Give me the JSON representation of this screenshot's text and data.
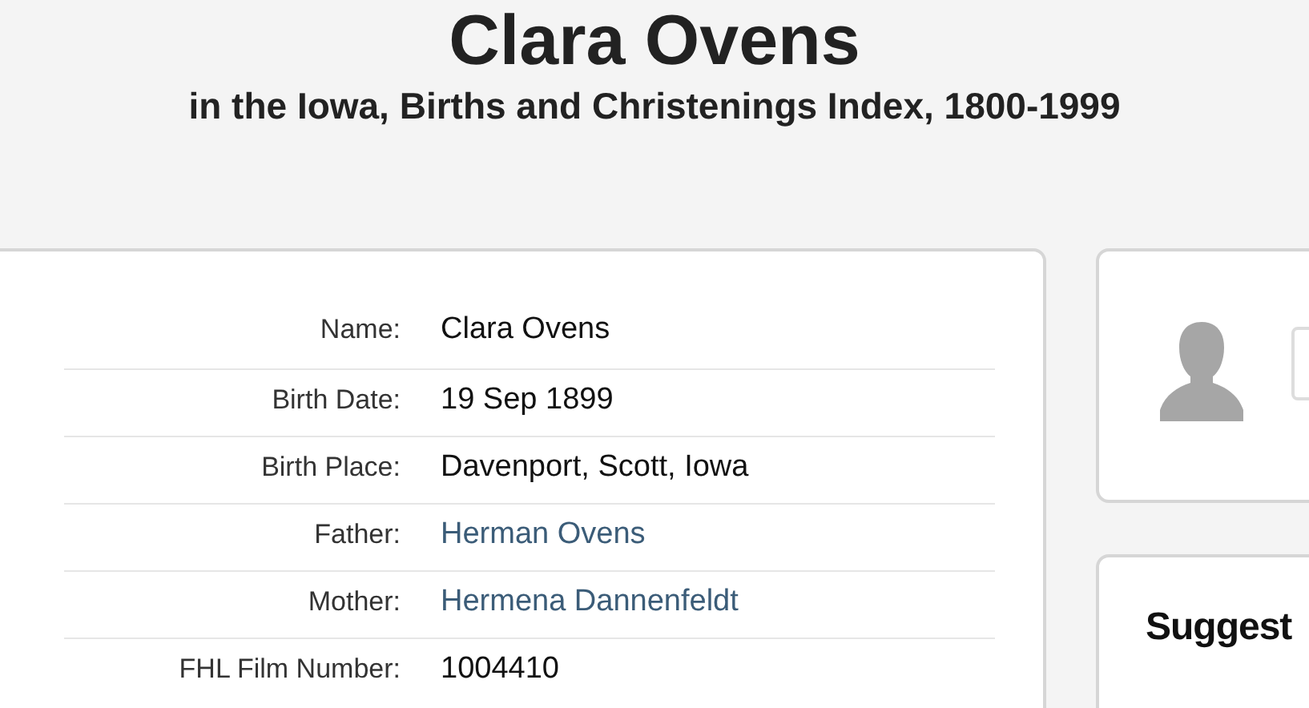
{
  "header": {
    "title": "Clara Ovens",
    "subtitle": "in the Iowa, Births and Christenings Index, 1800-1999"
  },
  "record": {
    "fields": [
      {
        "label": "Name:",
        "value": "Clara Ovens",
        "kind": "text"
      },
      {
        "label": "Birth Date:",
        "value": "19 Sep 1899",
        "kind": "text"
      },
      {
        "label": "Birth Place:",
        "value": "Davenport, Scott, Iowa",
        "kind": "text"
      },
      {
        "label": "Father:",
        "value": "Herman Ovens",
        "kind": "link"
      },
      {
        "label": "Mother:",
        "value": "Hermena Dannenfeldt",
        "kind": "link"
      },
      {
        "label": "FHL Film Number:",
        "value": "1004410",
        "kind": "text"
      }
    ]
  },
  "suggestions": {
    "title": "Suggest"
  }
}
